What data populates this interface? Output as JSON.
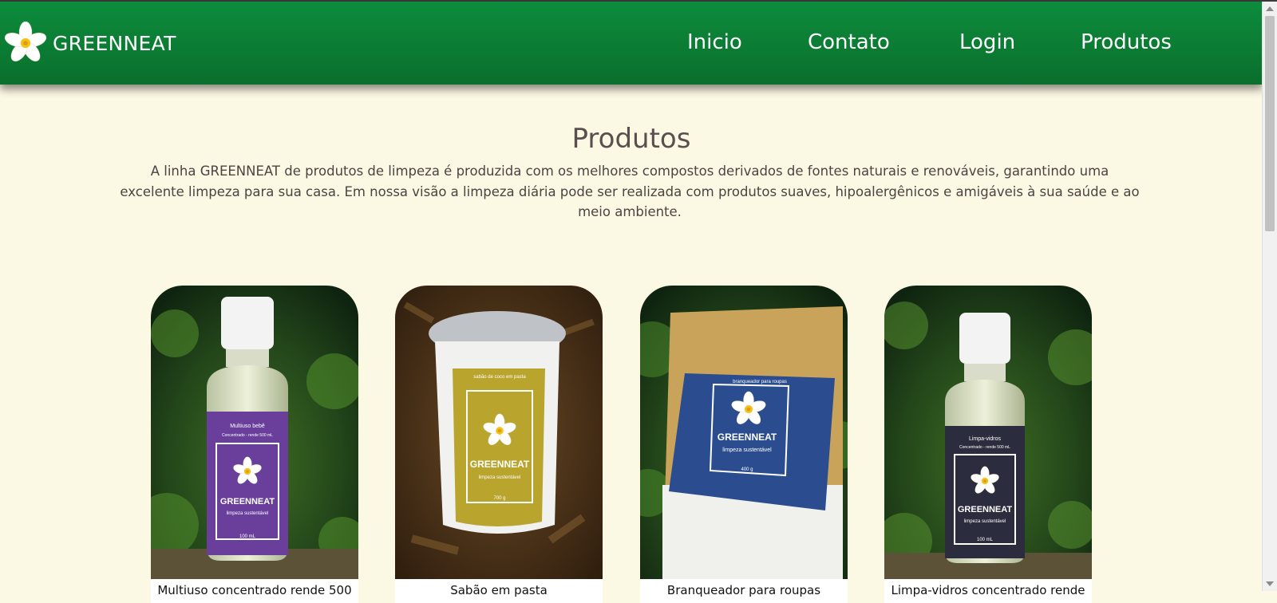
{
  "header": {
    "brand": "GREENNEAT",
    "logo_icon": "plumeria-flower-icon",
    "nav": [
      {
        "label": "Inicio"
      },
      {
        "label": "Contato"
      },
      {
        "label": "Login"
      },
      {
        "label": "Produtos"
      }
    ]
  },
  "main": {
    "title": "Produtos",
    "intro": "A linha GREENNEAT de produtos de limpeza é produzida com os melhores compostos derivados de fontes naturais e renováveis, garantindo uma excelente limpeza para sua casa. Em nossa visão a limpeza diária pode ser realizada com produtos suaves, hipoalergênicos e amigáveis à sua saúde e ao meio ambiente."
  },
  "products": [
    {
      "caption": "Multiuso concentrado rende 500",
      "label_line1": "Multiuso bebê",
      "label_line2": "Concentrado - rende 500 mL",
      "brand": "GREENNEAT",
      "tagline": "limpeza sustentável",
      "volume": "100 mL",
      "label_color": "#6a3f9c"
    },
    {
      "caption": "Sabão em pasta",
      "label_line1": "sabão de coco em pasta",
      "brand": "GREENNEAT",
      "tagline": "limpeza sustentável",
      "volume": "700 g",
      "label_color": "#b9a42e"
    },
    {
      "caption": "Branqueador para roupas",
      "label_line1": "branqueador para roupas",
      "brand": "GREENNEAT",
      "tagline": "limpeza sustentável",
      "volume": "400 g",
      "label_color": "#1f3b7a"
    },
    {
      "caption": "Limpa-vidros concentrado rende",
      "label_line1": "Limpa-vidros",
      "label_line2": "Concentrado - rende 500 mL",
      "brand": "GREENNEAT",
      "tagline": "limpeza sustentável",
      "volume": "100 mL",
      "label_color": "#2b2d3e"
    }
  ],
  "colors": {
    "navbar": "#0b7a32",
    "background": "#fbf8e3",
    "title_text": "#5a4e4e"
  }
}
